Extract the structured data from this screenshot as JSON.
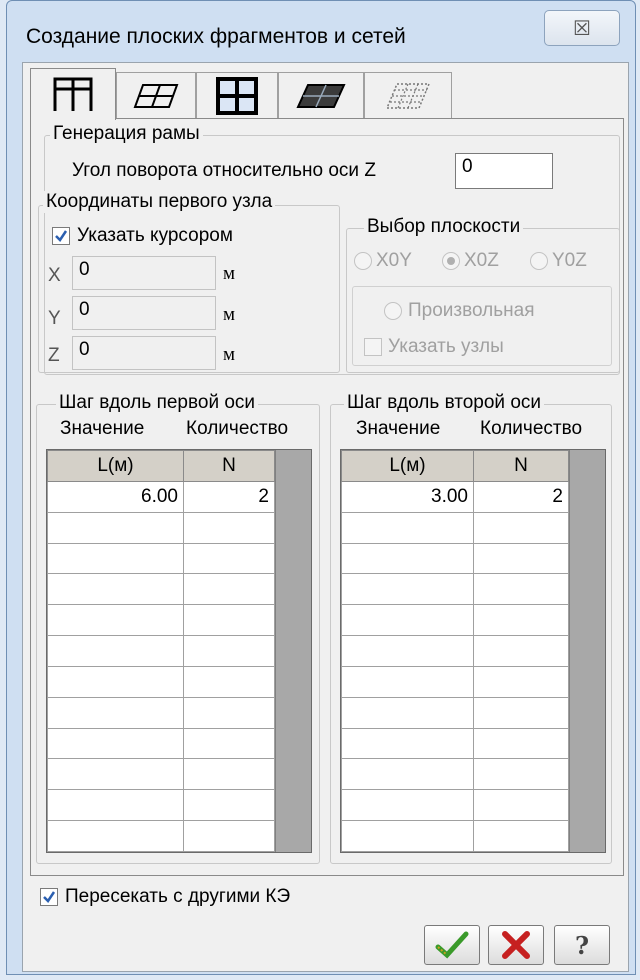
{
  "window": {
    "title": "Создание плоских фрагментов и сетей",
    "close_glyph": "☒"
  },
  "tabs": [
    {
      "icon": "frame-grid-icon",
      "active": true
    },
    {
      "icon": "plate-grid-icon",
      "active": false
    },
    {
      "icon": "bold-grid-icon",
      "active": false
    },
    {
      "icon": "slanted-plate-icon",
      "active": false
    },
    {
      "icon": "hatched-plate-icon",
      "active": false
    }
  ],
  "frame": {
    "group_label": "Генерация рамы",
    "angle_label": "Угол поворота относительно оси Z",
    "angle_value": "0"
  },
  "coords": {
    "group_label": "Координаты первого узла",
    "cursor_label": "Указать курсором",
    "cursor_checked": true,
    "x_label": "X",
    "x_value": "0",
    "y_label": "Y",
    "y_value": "0",
    "z_label": "Z",
    "z_value": "0",
    "unit": "м"
  },
  "plane": {
    "group_label": "Выбор плоскости",
    "xoy": "X0Y",
    "xoz": "X0Z",
    "yoz": "Y0Z",
    "selected": "X0Z",
    "arbitrary_label": "Произвольная",
    "nodes_label": "Указать узлы"
  },
  "axis1": {
    "group_label": "Шаг вдоль первой оси",
    "value_caption": "Значение",
    "count_caption": "Количество",
    "col_l": "L(м)",
    "col_n": "N",
    "rows": [
      {
        "l": "6.00",
        "n": "2"
      }
    ]
  },
  "axis2": {
    "group_label": "Шаг вдоль второй оси",
    "value_caption": "Значение",
    "count_caption": "Количество",
    "col_l": "L(м)",
    "col_n": "N",
    "rows": [
      {
        "l": "3.00",
        "n": "2"
      }
    ]
  },
  "intersect": {
    "label": "Пересекать с другими КЭ",
    "checked": true
  },
  "buttons": {
    "ok_icon": "checkmark-icon",
    "cancel_icon": "red-x-icon",
    "help_glyph": "?"
  },
  "colors": {
    "ok": "#3a9a2a",
    "cancel": "#c62020",
    "help": "#444444",
    "check": "#2b5fb0"
  }
}
